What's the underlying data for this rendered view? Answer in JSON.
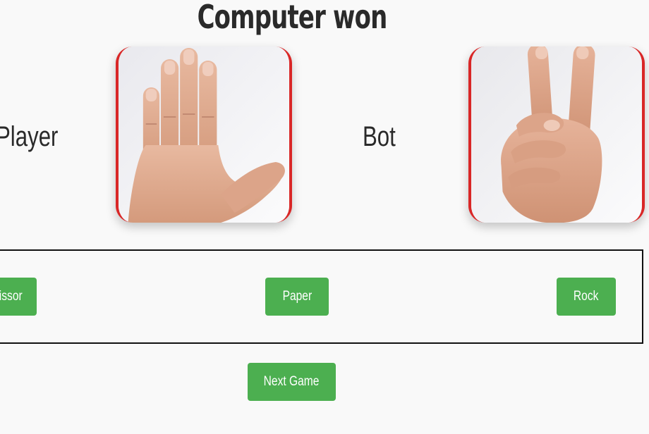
{
  "result": {
    "title": "Computer won"
  },
  "players": {
    "player_label": "Player",
    "bot_label": "Bot",
    "player_choice_icon": "open-hand-paper-icon",
    "bot_choice_icon": "two-fingers-scissor-icon"
  },
  "choices": {
    "scissor_label": "Scissor",
    "paper_label": "Paper",
    "rock_label": "Rock"
  },
  "controls": {
    "next_game_label": "Next Game"
  },
  "colors": {
    "button_green": "#4caf50",
    "card_accent_red": "#d92727",
    "background": "#f9f9f9"
  }
}
